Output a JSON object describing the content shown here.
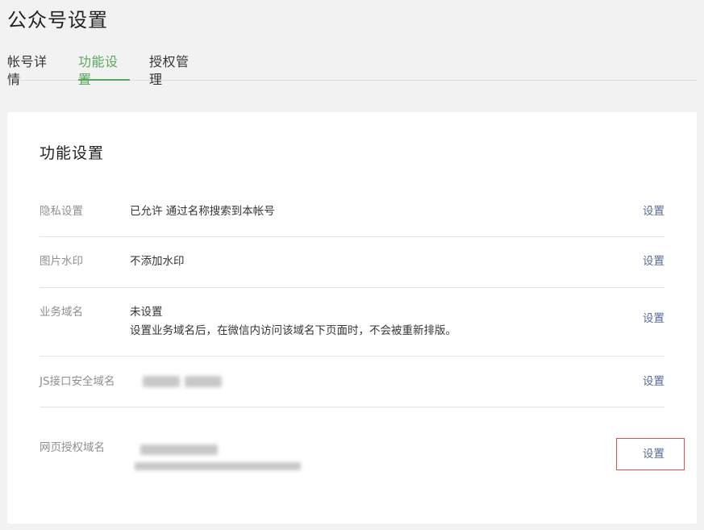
{
  "page": {
    "title": "公众号设置"
  },
  "tabs": [
    {
      "label": "帐号详情"
    },
    {
      "label": "功能设置",
      "active": true
    },
    {
      "label": "授权管理"
    }
  ],
  "card": {
    "title": "功能设置"
  },
  "rows": [
    {
      "label": "隐私设置",
      "value": "已允许 通过名称搜索到本帐号",
      "action": "设置"
    },
    {
      "label": "图片水印",
      "value": "不添加水印",
      "action": "设置"
    },
    {
      "label": "业务域名",
      "value": "未设置",
      "value2": "设置业务域名后，在微信内访问该域名下页面时，不会被重新排版。",
      "action": "设置"
    },
    {
      "label": "JS接口安全域名",
      "value": "",
      "action": "设置"
    },
    {
      "label": "网页授权域名",
      "value": "",
      "action": "设置"
    }
  ],
  "colors": {
    "accent": "#5aa65f",
    "link": "#576b95",
    "highlight": "#d9534f"
  }
}
